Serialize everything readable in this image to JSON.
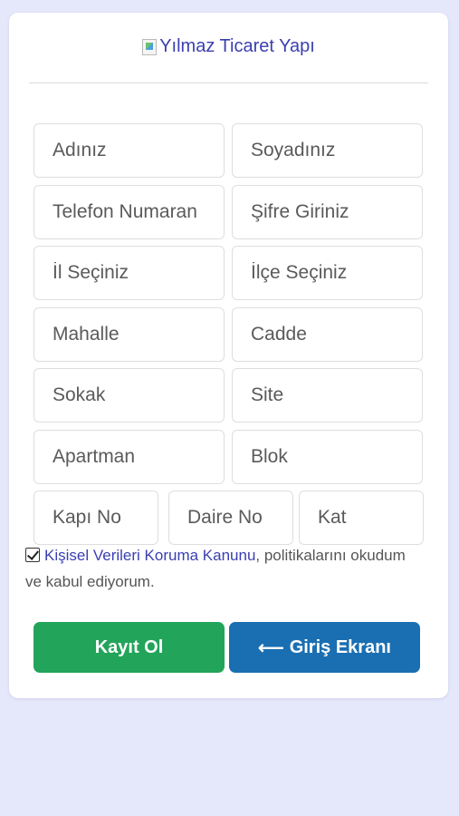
{
  "header": {
    "logo_alt": "Yılmaz Ticaret Yapı"
  },
  "form": {
    "fields": [
      {
        "placeholder": "Adınız"
      },
      {
        "placeholder": "Soyadınız"
      },
      {
        "placeholder": "Telefon Numaran"
      },
      {
        "placeholder": "Şifre Giriniz"
      },
      {
        "placeholder": "İl Seçiniz"
      },
      {
        "placeholder": "İlçe Seçiniz"
      },
      {
        "placeholder": "Mahalle"
      },
      {
        "placeholder": "Cadde"
      },
      {
        "placeholder": "Sokak"
      },
      {
        "placeholder": "Site"
      },
      {
        "placeholder": "Apartman"
      },
      {
        "placeholder": "Blok"
      },
      {
        "placeholder": "Kapı No"
      },
      {
        "placeholder": "Daire No"
      },
      {
        "placeholder": "Kat"
      }
    ],
    "consent": {
      "checked": true,
      "link_text": "Kişisel Verileri Koruma Kanunu",
      "text": ", politikalarını okudum ve kabul ediyorum."
    }
  },
  "buttons": {
    "register_label": "Kayıt Ol",
    "login_label": "Giriş Ekranı",
    "login_icon": "arrow-left-icon"
  },
  "colors": {
    "background": "#e5e7fb",
    "register": "#22a45a",
    "login": "#1a6fb2",
    "link": "#3a3fb0"
  }
}
